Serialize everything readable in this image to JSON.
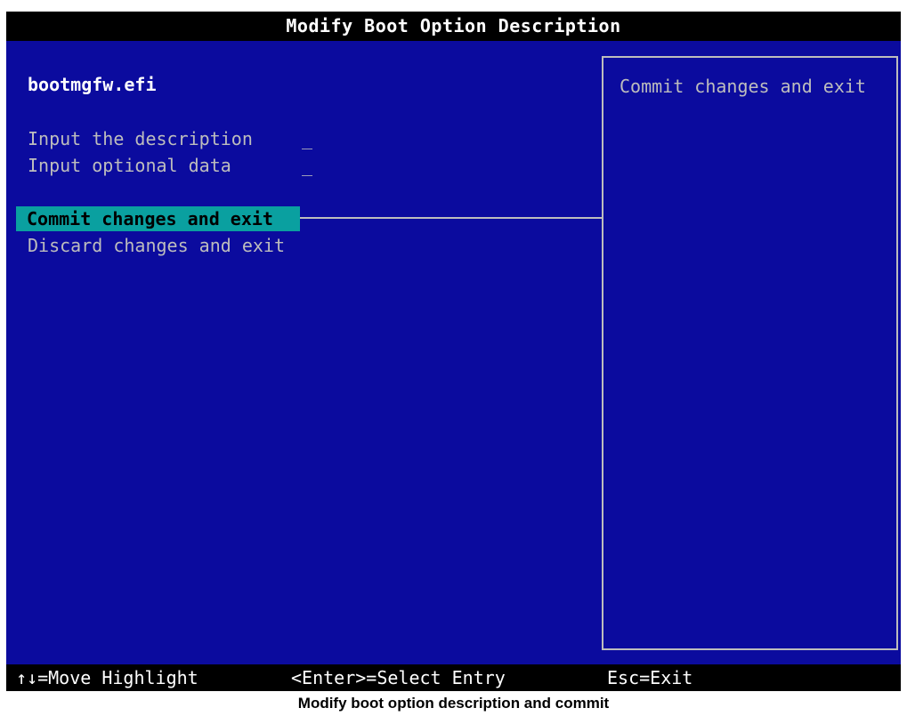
{
  "window": {
    "title": "Modify Boot Option Description"
  },
  "boot_option": {
    "filename": "bootmgfw.efi"
  },
  "fields": [
    {
      "label": "Input the description",
      "value": "_"
    },
    {
      "label": "Input optional data",
      "value": "_"
    }
  ],
  "menu": {
    "commit_label": "Commit changes and exit",
    "discard_label": "Discard changes and exit",
    "selected": "commit"
  },
  "help": {
    "text": "Commit changes and exit"
  },
  "footer": {
    "move_hint": "↑↓=Move Highlight",
    "select_hint": "<Enter>=Select Entry",
    "exit_hint": "Esc=Exit"
  },
  "caption": "Modify boot option description and commit",
  "colors": {
    "background": "#0b0b9e",
    "bar": "#000000",
    "highlight": "#0aa0a0",
    "text": "#bdbdbd"
  }
}
